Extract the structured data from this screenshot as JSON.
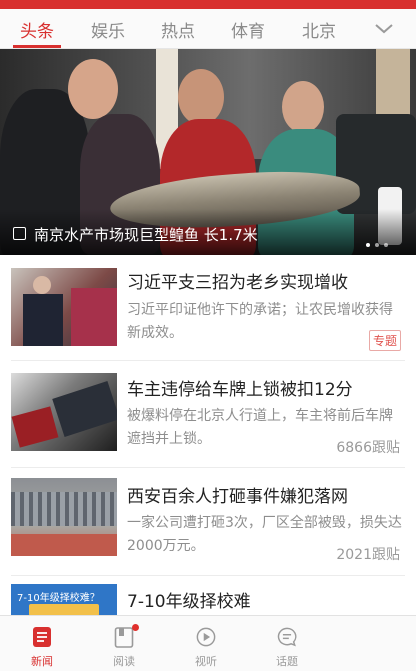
{
  "tabs": [
    {
      "label": "头条",
      "active": true
    },
    {
      "label": "娱乐",
      "active": false
    },
    {
      "label": "热点",
      "active": false
    },
    {
      "label": "体育",
      "active": false
    },
    {
      "label": "北京",
      "active": false
    }
  ],
  "tabs_more_icon": "chevron-down-icon",
  "hero": {
    "caption": "南京水产市场现巨型鳇鱼 长1.7米",
    "icon": "gallery-icon"
  },
  "news": [
    {
      "title": "习近平支三招为老乡实现增收",
      "desc": "习近平印证他许下的承诺；让农民增收获得新成效。",
      "tag": "专题"
    },
    {
      "title": "车主违停给车牌上锁被扣12分",
      "desc": "被爆料停在北京人行道上，车主将前后车牌遮挡并上锁。",
      "meta": "6866跟贴"
    },
    {
      "title": "西安百余人打砸事件嫌犯落网",
      "desc": "一家公司遭打砸3次，厂区全部被毁，损失达2000万元。",
      "meta": "2021跟贴"
    },
    {
      "title": "7-10年级择校难",
      "thumb_text": "7-10年级择校难？"
    }
  ],
  "bottom_nav": [
    {
      "label": "新闻",
      "icon": "news-icon",
      "active": true
    },
    {
      "label": "阅读",
      "icon": "reading-icon",
      "active": false
    },
    {
      "label": "视听",
      "icon": "play-icon",
      "active": false
    },
    {
      "label": "话题",
      "icon": "topic-icon",
      "active": false
    }
  ],
  "colors": {
    "accent": "#d8302f",
    "muted": "#8e8e8e"
  }
}
